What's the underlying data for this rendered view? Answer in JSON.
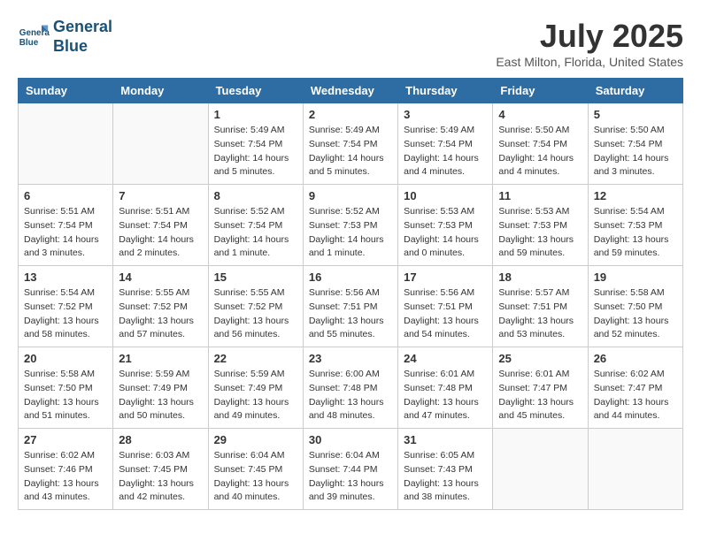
{
  "header": {
    "logo_line1": "General",
    "logo_line2": "Blue",
    "month_year": "July 2025",
    "location": "East Milton, Florida, United States"
  },
  "weekdays": [
    "Sunday",
    "Monday",
    "Tuesday",
    "Wednesday",
    "Thursday",
    "Friday",
    "Saturday"
  ],
  "weeks": [
    [
      {
        "day": "",
        "sunrise": "",
        "sunset": "",
        "daylight": "",
        "empty": true
      },
      {
        "day": "",
        "sunrise": "",
        "sunset": "",
        "daylight": "",
        "empty": true
      },
      {
        "day": "1",
        "sunrise": "Sunrise: 5:49 AM",
        "sunset": "Sunset: 7:54 PM",
        "daylight": "Daylight: 14 hours and 5 minutes."
      },
      {
        "day": "2",
        "sunrise": "Sunrise: 5:49 AM",
        "sunset": "Sunset: 7:54 PM",
        "daylight": "Daylight: 14 hours and 5 minutes."
      },
      {
        "day": "3",
        "sunrise": "Sunrise: 5:49 AM",
        "sunset": "Sunset: 7:54 PM",
        "daylight": "Daylight: 14 hours and 4 minutes."
      },
      {
        "day": "4",
        "sunrise": "Sunrise: 5:50 AM",
        "sunset": "Sunset: 7:54 PM",
        "daylight": "Daylight: 14 hours and 4 minutes."
      },
      {
        "day": "5",
        "sunrise": "Sunrise: 5:50 AM",
        "sunset": "Sunset: 7:54 PM",
        "daylight": "Daylight: 14 hours and 3 minutes."
      }
    ],
    [
      {
        "day": "6",
        "sunrise": "Sunrise: 5:51 AM",
        "sunset": "Sunset: 7:54 PM",
        "daylight": "Daylight: 14 hours and 3 minutes."
      },
      {
        "day": "7",
        "sunrise": "Sunrise: 5:51 AM",
        "sunset": "Sunset: 7:54 PM",
        "daylight": "Daylight: 14 hours and 2 minutes."
      },
      {
        "day": "8",
        "sunrise": "Sunrise: 5:52 AM",
        "sunset": "Sunset: 7:54 PM",
        "daylight": "Daylight: 14 hours and 1 minute."
      },
      {
        "day": "9",
        "sunrise": "Sunrise: 5:52 AM",
        "sunset": "Sunset: 7:53 PM",
        "daylight": "Daylight: 14 hours and 1 minute."
      },
      {
        "day": "10",
        "sunrise": "Sunrise: 5:53 AM",
        "sunset": "Sunset: 7:53 PM",
        "daylight": "Daylight: 14 hours and 0 minutes."
      },
      {
        "day": "11",
        "sunrise": "Sunrise: 5:53 AM",
        "sunset": "Sunset: 7:53 PM",
        "daylight": "Daylight: 13 hours and 59 minutes."
      },
      {
        "day": "12",
        "sunrise": "Sunrise: 5:54 AM",
        "sunset": "Sunset: 7:53 PM",
        "daylight": "Daylight: 13 hours and 59 minutes."
      }
    ],
    [
      {
        "day": "13",
        "sunrise": "Sunrise: 5:54 AM",
        "sunset": "Sunset: 7:52 PM",
        "daylight": "Daylight: 13 hours and 58 minutes."
      },
      {
        "day": "14",
        "sunrise": "Sunrise: 5:55 AM",
        "sunset": "Sunset: 7:52 PM",
        "daylight": "Daylight: 13 hours and 57 minutes."
      },
      {
        "day": "15",
        "sunrise": "Sunrise: 5:55 AM",
        "sunset": "Sunset: 7:52 PM",
        "daylight": "Daylight: 13 hours and 56 minutes."
      },
      {
        "day": "16",
        "sunrise": "Sunrise: 5:56 AM",
        "sunset": "Sunset: 7:51 PM",
        "daylight": "Daylight: 13 hours and 55 minutes."
      },
      {
        "day": "17",
        "sunrise": "Sunrise: 5:56 AM",
        "sunset": "Sunset: 7:51 PM",
        "daylight": "Daylight: 13 hours and 54 minutes."
      },
      {
        "day": "18",
        "sunrise": "Sunrise: 5:57 AM",
        "sunset": "Sunset: 7:51 PM",
        "daylight": "Daylight: 13 hours and 53 minutes."
      },
      {
        "day": "19",
        "sunrise": "Sunrise: 5:58 AM",
        "sunset": "Sunset: 7:50 PM",
        "daylight": "Daylight: 13 hours and 52 minutes."
      }
    ],
    [
      {
        "day": "20",
        "sunrise": "Sunrise: 5:58 AM",
        "sunset": "Sunset: 7:50 PM",
        "daylight": "Daylight: 13 hours and 51 minutes."
      },
      {
        "day": "21",
        "sunrise": "Sunrise: 5:59 AM",
        "sunset": "Sunset: 7:49 PM",
        "daylight": "Daylight: 13 hours and 50 minutes."
      },
      {
        "day": "22",
        "sunrise": "Sunrise: 5:59 AM",
        "sunset": "Sunset: 7:49 PM",
        "daylight": "Daylight: 13 hours and 49 minutes."
      },
      {
        "day": "23",
        "sunrise": "Sunrise: 6:00 AM",
        "sunset": "Sunset: 7:48 PM",
        "daylight": "Daylight: 13 hours and 48 minutes."
      },
      {
        "day": "24",
        "sunrise": "Sunrise: 6:01 AM",
        "sunset": "Sunset: 7:48 PM",
        "daylight": "Daylight: 13 hours and 47 minutes."
      },
      {
        "day": "25",
        "sunrise": "Sunrise: 6:01 AM",
        "sunset": "Sunset: 7:47 PM",
        "daylight": "Daylight: 13 hours and 45 minutes."
      },
      {
        "day": "26",
        "sunrise": "Sunrise: 6:02 AM",
        "sunset": "Sunset: 7:47 PM",
        "daylight": "Daylight: 13 hours and 44 minutes."
      }
    ],
    [
      {
        "day": "27",
        "sunrise": "Sunrise: 6:02 AM",
        "sunset": "Sunset: 7:46 PM",
        "daylight": "Daylight: 13 hours and 43 minutes."
      },
      {
        "day": "28",
        "sunrise": "Sunrise: 6:03 AM",
        "sunset": "Sunset: 7:45 PM",
        "daylight": "Daylight: 13 hours and 42 minutes."
      },
      {
        "day": "29",
        "sunrise": "Sunrise: 6:04 AM",
        "sunset": "Sunset: 7:45 PM",
        "daylight": "Daylight: 13 hours and 40 minutes."
      },
      {
        "day": "30",
        "sunrise": "Sunrise: 6:04 AM",
        "sunset": "Sunset: 7:44 PM",
        "daylight": "Daylight: 13 hours and 39 minutes."
      },
      {
        "day": "31",
        "sunrise": "Sunrise: 6:05 AM",
        "sunset": "Sunset: 7:43 PM",
        "daylight": "Daylight: 13 hours and 38 minutes."
      },
      {
        "day": "",
        "sunrise": "",
        "sunset": "",
        "daylight": "",
        "empty": true
      },
      {
        "day": "",
        "sunrise": "",
        "sunset": "",
        "daylight": "",
        "empty": true
      }
    ]
  ]
}
